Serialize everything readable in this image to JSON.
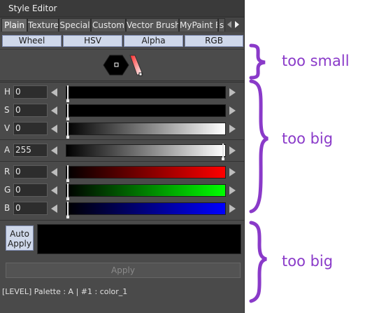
{
  "window": {
    "title": "Style Editor"
  },
  "tabs": [
    {
      "label": "Plain",
      "active": true
    },
    {
      "label": "Texture"
    },
    {
      "label": "Special"
    },
    {
      "label": "Custom"
    },
    {
      "label": "Vector Brush"
    },
    {
      "label": "MyPaint B"
    },
    {
      "label": "s"
    }
  ],
  "mode_buttons": [
    {
      "label": "Wheel"
    },
    {
      "label": "HSV"
    },
    {
      "label": "Alpha"
    },
    {
      "label": "RGB"
    }
  ],
  "channels": {
    "H": {
      "label": "H",
      "value": "0"
    },
    "S": {
      "label": "S",
      "value": "0"
    },
    "V": {
      "label": "V",
      "value": "0"
    },
    "A": {
      "label": "A",
      "value": "255"
    },
    "R": {
      "label": "R",
      "value": "0"
    },
    "G": {
      "label": "G",
      "value": "0"
    },
    "B": {
      "label": "B",
      "value": "0"
    }
  },
  "auto_apply": {
    "line1": "Auto",
    "line2": "Apply"
  },
  "apply_button": {
    "label": "Apply"
  },
  "status": {
    "text": "[LEVEL]   Palette : A | #1 : color_1"
  },
  "annotations": [
    "too small",
    "too big",
    "too big"
  ],
  "colors": {
    "current_color": "#000000",
    "annotation": "#8a3ac9",
    "red_channel": "#ff0000",
    "green_channel": "#00ff00",
    "blue_channel": "#0000ff"
  }
}
